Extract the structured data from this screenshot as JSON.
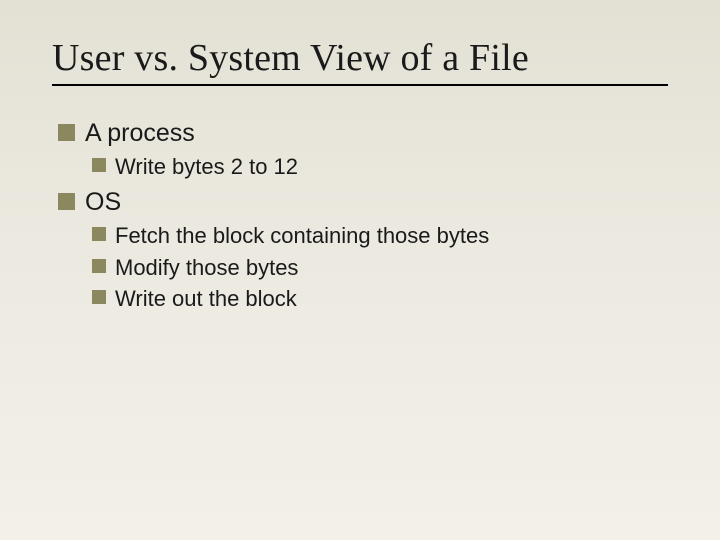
{
  "title": "User vs. System View of a File",
  "items": [
    {
      "label": "A process",
      "children": [
        {
          "label": "Write bytes 2 to 12"
        }
      ]
    },
    {
      "label": "OS",
      "children": [
        {
          "label": "Fetch the block containing those bytes"
        },
        {
          "label": "Modify those bytes"
        },
        {
          "label": "Write out the block"
        }
      ]
    }
  ]
}
